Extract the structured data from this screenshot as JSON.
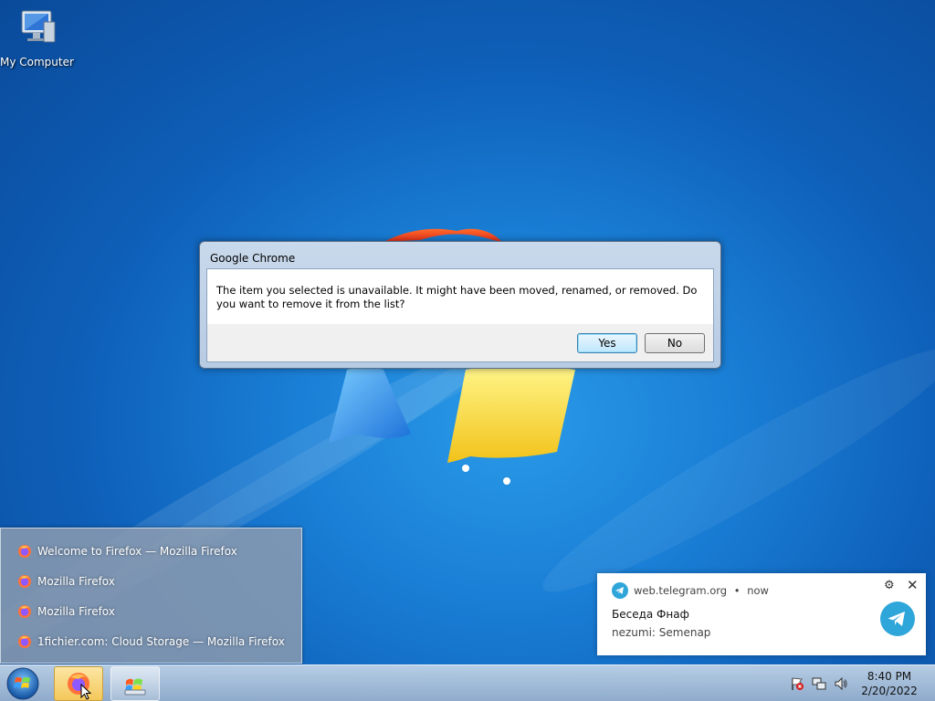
{
  "desktop": {
    "icons": [
      {
        "label": "My Computer"
      }
    ]
  },
  "dialog": {
    "title": "Google Chrome",
    "message": "The item you selected is unavailable.  It might have been moved, renamed, or removed.  Do you want to remove it from the list?",
    "yes_label": "Yes",
    "no_label": "No"
  },
  "jumplist": {
    "items": [
      {
        "label": "Welcome to Firefox — Mozilla Firefox",
        "icon": "firefox-icon"
      },
      {
        "label": "Mozilla Firefox",
        "icon": "firefox-icon"
      },
      {
        "label": "Mozilla Firefox",
        "icon": "firefox-icon"
      },
      {
        "label": "1fichier.com: Cloud Storage — Mozilla Firefox",
        "icon": "firefox-icon"
      }
    ]
  },
  "notification": {
    "source": "web.telegram.org",
    "separator": "•",
    "time": "now",
    "title": "Беседа Фнаф",
    "body": "nezumi: Semenap",
    "icon": "telegram-icon"
  },
  "taskbar": {
    "clock_time": "8:40 PM",
    "clock_date": "2/20/2022",
    "pinned": [
      "firefox-icon",
      "explorer-icon"
    ],
    "tray": [
      "action-center-flag-icon",
      "network-icon",
      "volume-icon"
    ]
  },
  "colors": {
    "desktop_blue": "#1a7fd6",
    "telegram_blue": "#2ea6da",
    "firefox_orange": "#ff7139"
  }
}
